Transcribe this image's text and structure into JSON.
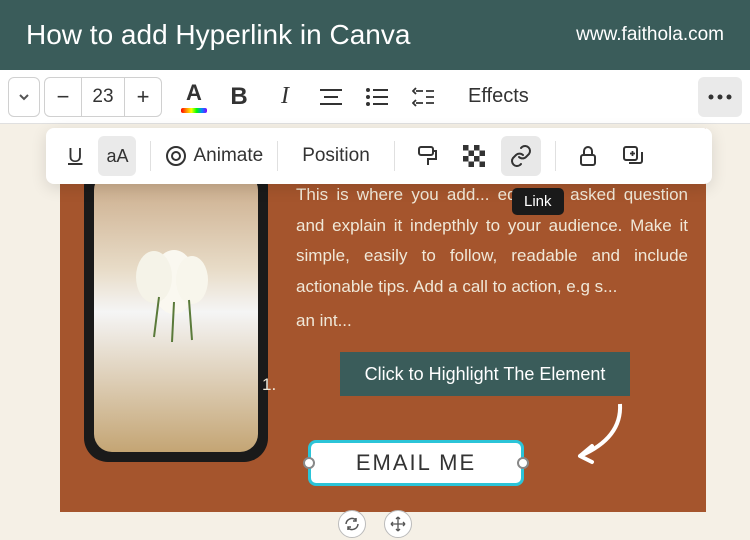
{
  "header": {
    "title": "How to add Hyperlink in Canva",
    "url": "www.faithola.com"
  },
  "toolbar": {
    "font_size": "23",
    "font_color_label": "A",
    "bold_label": "B",
    "italic_label": "I",
    "effects_label": "Effects"
  },
  "secondary_toolbar": {
    "underline_label": "U",
    "case_label": "aA",
    "animate_label": "Animate",
    "position_label": "Position",
    "link_tooltip": "Link"
  },
  "canvas": {
    "body_text": "This is where you add... equently asked question and explain it indepthly to your audience. Make it simple, easily to follow, readable and include actionable tips. Add a call to action, e.g s...",
    "body_text_end": "an int...",
    "callout_text": "Click to Highlight The Element",
    "button_text": "EMAIL ME",
    "list_marker": "1."
  },
  "colors": {
    "header_bg": "#3a5c5a",
    "canvas_bg": "#a5552d",
    "selection_border": "#2bc4d8"
  }
}
